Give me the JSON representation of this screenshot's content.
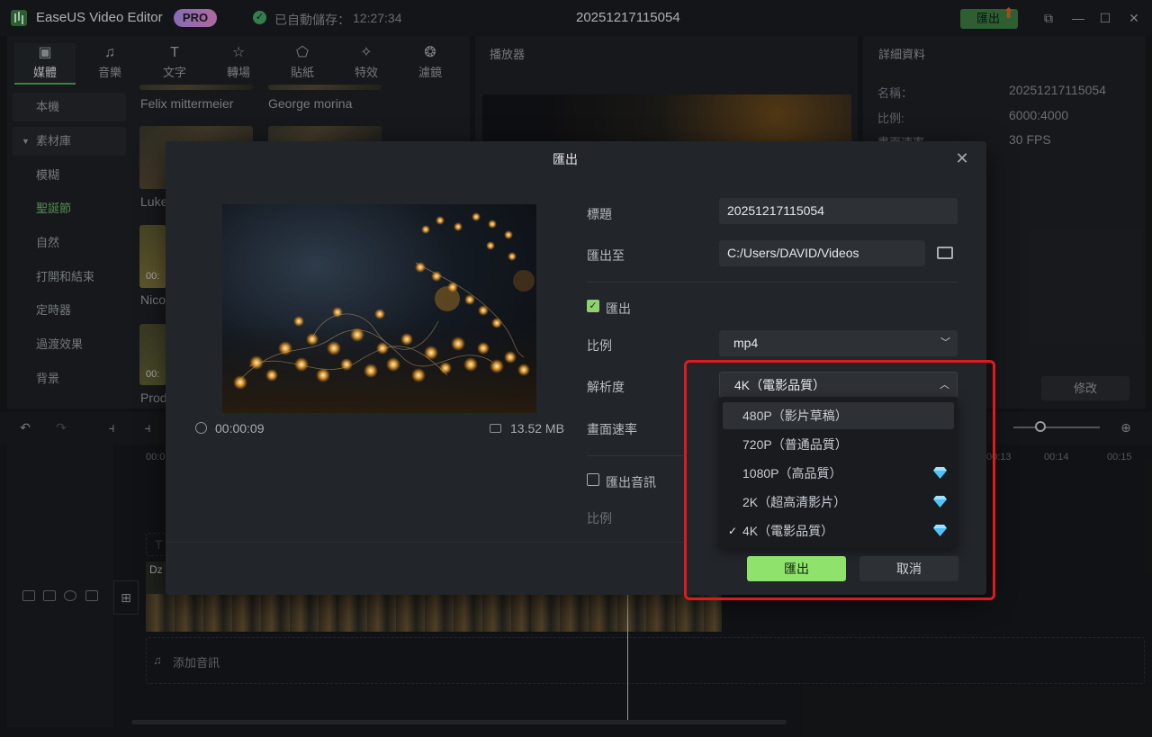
{
  "titlebar": {
    "app_name": "EaseUS Video Editor",
    "pro_badge": "PRO",
    "autosave_label": "已自動儲存：",
    "autosave_time": "12:27:34",
    "project_title": "20251217115054",
    "export_button": "匯出"
  },
  "media_tabs": [
    {
      "label": "媒體",
      "icon": "media-icon"
    },
    {
      "label": "音樂",
      "icon": "music-icon"
    },
    {
      "label": "文字",
      "icon": "text-icon"
    },
    {
      "label": "轉場",
      "icon": "transition-icon"
    },
    {
      "label": "貼紙",
      "icon": "sticker-icon"
    },
    {
      "label": "特效",
      "icon": "effects-icon"
    },
    {
      "label": "濾鏡",
      "icon": "filter-icon"
    }
  ],
  "sidebar": {
    "items": [
      {
        "label": "本機"
      },
      {
        "label": "素材庫"
      },
      {
        "label": "模糊"
      },
      {
        "label": "聖誕節"
      },
      {
        "label": "自然"
      },
      {
        "label": "打開和結束"
      },
      {
        "label": "定時器"
      },
      {
        "label": "過渡效果"
      },
      {
        "label": "背景"
      }
    ]
  },
  "media_grid": {
    "labels": [
      "Felix mittermeier",
      "George morina",
      "Luke",
      "Nico",
      "Prod"
    ],
    "durations": [
      "00:",
      "00:"
    ]
  },
  "player": {
    "title": "播放器"
  },
  "details": {
    "title": "詳細資料",
    "rows": [
      {
        "label": "名稱：",
        "value": "20251217115054"
      },
      {
        "label": "比例:",
        "value": "6000:4000"
      },
      {
        "label": "畫面速率",
        "value": "30 FPS"
      }
    ],
    "modify_button": "修改"
  },
  "timeline": {
    "ruler": [
      "00:0",
      "00:13",
      "00:14",
      "00:15"
    ],
    "clip_label": "Dz",
    "text_track_label": "T",
    "audio_placeholder": "添加音訊"
  },
  "export_dialog": {
    "title": "匯出",
    "duration": "00:00:09",
    "file_size": "13.52 MB",
    "fields": {
      "title_label": "標題",
      "title_value": "20251217115054",
      "export_to_label": "匯出至",
      "export_to_value": "C:/Users/DAVID/Videos",
      "export_checkbox_label": "匯出",
      "format_label": "比例",
      "format_value": "mp4",
      "resolution_label": "解析度",
      "resolution_value": "4K（電影品質）",
      "framerate_label": "畫面速率",
      "export_audio_label": "匯出音訊",
      "audio_ratio_label": "比例"
    },
    "resolution_options": [
      {
        "label": "480P（影片草稿）",
        "premium": false,
        "selected": false,
        "hover": true
      },
      {
        "label": "720P（普通品質）",
        "premium": false,
        "selected": false,
        "hover": false
      },
      {
        "label": "1080P（高品質）",
        "premium": true,
        "selected": false,
        "hover": false
      },
      {
        "label": "2K（超高清影片）",
        "premium": true,
        "selected": false,
        "hover": false
      },
      {
        "label": "4K（電影品質）",
        "premium": true,
        "selected": true,
        "hover": false
      }
    ],
    "check_mark": "✓",
    "export_button": "匯出",
    "cancel_button": "取消"
  },
  "colors": {
    "accent_green": "#8fe36d",
    "highlight_red": "#e0191e",
    "premium_gem": "#4fc3f7"
  }
}
